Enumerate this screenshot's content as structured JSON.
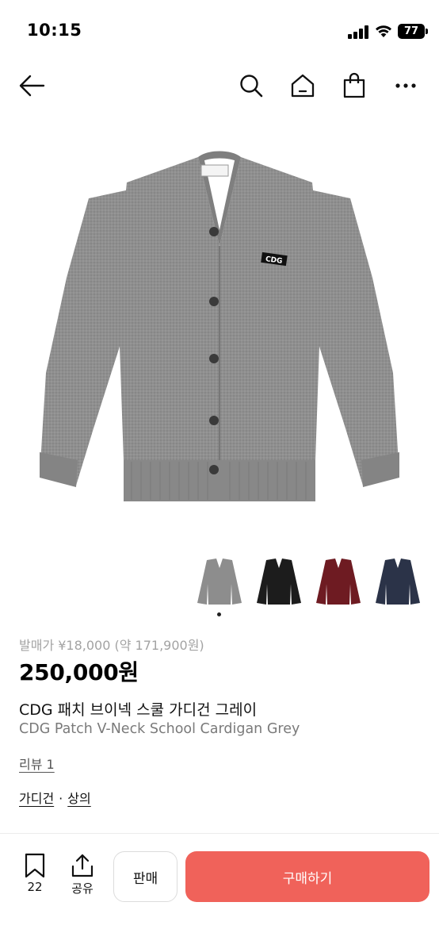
{
  "status_bar": {
    "time": "10:15",
    "battery": "77"
  },
  "nav": {
    "icons": [
      "back-arrow-icon",
      "search-icon",
      "home-icon",
      "shopping-bag-icon",
      "more-icon"
    ]
  },
  "product": {
    "image_alt_colors": [
      "#8d8d8d",
      "#1c1c1c",
      "#6e1b22",
      "#2b3348"
    ],
    "patch_text": "CDG",
    "original_price": "발매가 ¥18,000 (약 171,900원)",
    "price": "250,000원",
    "title_ko": "CDG 패치 브이넥 스쿨 가디건 그레이",
    "title_en": "CDG Patch V-Neck School Cardigan Grey",
    "review_link": "리뷰 1",
    "category": {
      "primary": "가디건",
      "secondary": "상의",
      "separator": "·"
    }
  },
  "bottom_bar": {
    "bookmark_count": "22",
    "share_label": "공유",
    "sell_label": "판매",
    "buy_label": "구매하기",
    "accent_color": "#f0625a"
  }
}
